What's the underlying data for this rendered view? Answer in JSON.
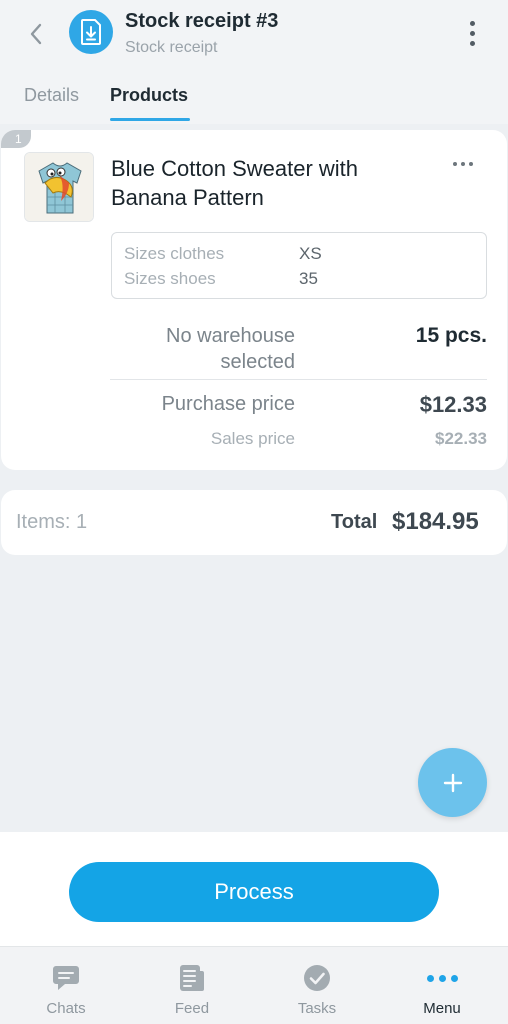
{
  "header": {
    "title": "Stock receipt #3",
    "subtitle": "Stock receipt",
    "back_icon": "chevron-left-icon",
    "document_icon": "download-document-icon",
    "menu_icon": "more-vertical-icon"
  },
  "tabs": [
    {
      "label": "Details",
      "active": false
    },
    {
      "label": "Products",
      "active": true
    }
  ],
  "product": {
    "index": "1",
    "name": "Blue Cotton Sweater with Banana Pattern",
    "properties": [
      {
        "label": "Sizes clothes",
        "value": "XS"
      },
      {
        "label": "Sizes shoes",
        "value": "35"
      }
    ],
    "warehouse": "No warehouse selected",
    "quantity": "15 pcs.",
    "purchase_price_label": "Purchase price",
    "purchase_price": "$12.33",
    "sales_price_label": "Sales price",
    "sales_price": "$22.33"
  },
  "totals": {
    "items": "Items: 1",
    "total_label": "Total",
    "total_value": "$184.95"
  },
  "actions": {
    "add_icon": "plus-icon",
    "process_label": "Process"
  },
  "nav": [
    {
      "label": "Chats",
      "icon": "chat-bubble-icon",
      "active": false
    },
    {
      "label": "Feed",
      "icon": "feed-icon",
      "active": false
    },
    {
      "label": "Tasks",
      "icon": "check-circle-icon",
      "active": false
    },
    {
      "label": "Menu",
      "icon": "more-horizontal-icon",
      "active": true
    }
  ],
  "colors": {
    "accent": "#14a4e6",
    "fab": "#6cc2ec",
    "background": "#edf0f3"
  }
}
